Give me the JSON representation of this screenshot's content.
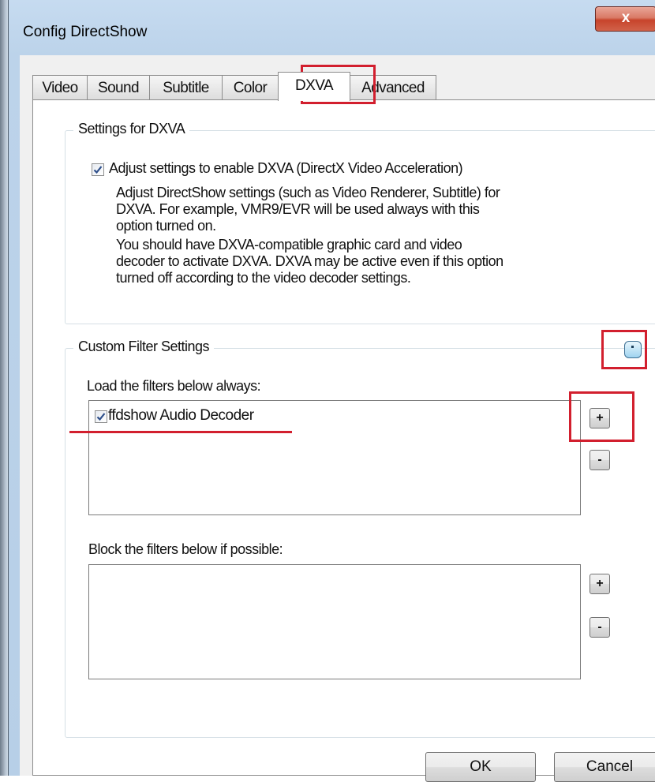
{
  "window": {
    "title": "Config DirectShow",
    "close_glyph": "x"
  },
  "tabs": [
    {
      "label": "Video"
    },
    {
      "label": "Sound"
    },
    {
      "label": "Subtitle"
    },
    {
      "label": "Color"
    },
    {
      "label": "DXVA",
      "active": true
    },
    {
      "label": "Advanced"
    }
  ],
  "dxva_group": {
    "title": "Settings for DXVA",
    "checkbox_label": "Adjust settings to enable DXVA (DirectX Video Acceleration)",
    "checked": true,
    "desc1_lines": [
      "Adjust DirectShow settings (such as Video Renderer, Subtitle) for",
      "DXVA. For example, VMR9/EVR will be used always with this",
      "option turned on."
    ],
    "desc2_lines": [
      "You should have DXVA-compatible graphic card and video",
      "decoder to activate DXVA. DXVA may be active even if this option",
      "turned off according to the video decoder settings."
    ]
  },
  "custom_group": {
    "title": "Custom Filter Settings",
    "icon": "collapse-icon",
    "load_label": "Load the filters below always:",
    "load_items": [
      {
        "label": "ffdshow Audio Decoder",
        "checked": true
      }
    ],
    "block_label": "Block the filters below if possible:",
    "add_label": "+",
    "remove_label": "-"
  },
  "buttons": {
    "ok": "OK",
    "cancel": "Cancel"
  },
  "colors": {
    "annotation_red": "#d21f2e",
    "title_bar": "#bcd3ea",
    "close_button": "#c7442b"
  }
}
